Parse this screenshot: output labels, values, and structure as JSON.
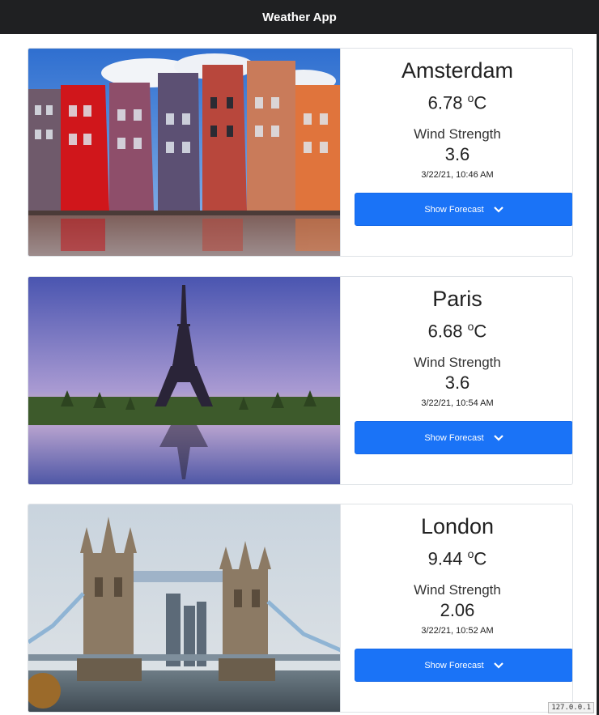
{
  "header": {
    "title": "Weather App"
  },
  "cities": [
    {
      "name": "Amsterdam",
      "temp": "6.78",
      "unit": "o",
      "unit_suffix": "C",
      "wind_label": "Wind Strength",
      "wind": "3.6",
      "time": "3/22/21, 10:46 AM",
      "button": "Show Forecast"
    },
    {
      "name": "Paris",
      "temp": "6.68",
      "unit": "o",
      "unit_suffix": "C",
      "wind_label": "Wind Strength",
      "wind": "3.6",
      "time": "3/22/21, 10:54 AM",
      "button": "Show Forecast"
    },
    {
      "name": "London",
      "temp": "9.44",
      "unit": "o",
      "unit_suffix": "C",
      "wind_label": "Wind Strength",
      "wind": "2.06",
      "time": "3/22/21, 10:52 AM",
      "button": "Show Forecast"
    }
  ],
  "footer": {
    "host": "127.0.0.1"
  },
  "colors": {
    "accent": "#1a73f7",
    "topbar": "#1f2022",
    "border": "#dee2e6"
  }
}
